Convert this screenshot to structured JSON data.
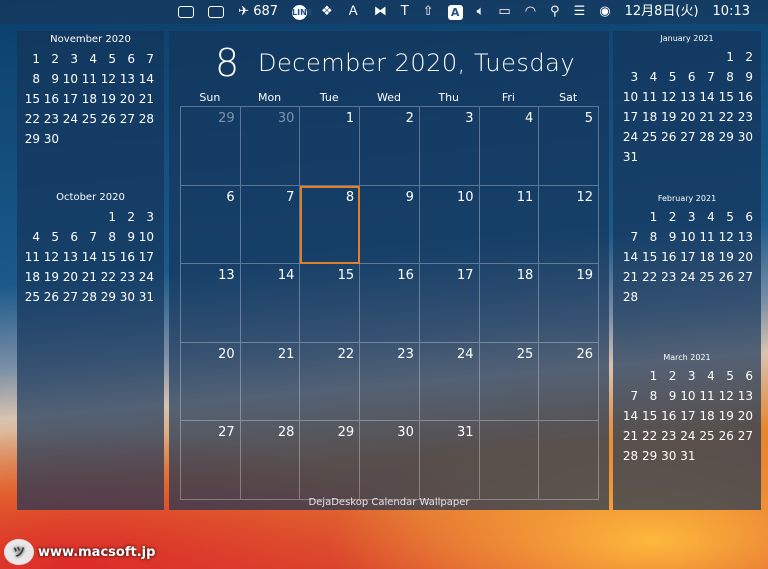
{
  "menubar": {
    "flight_count": "687",
    "line_label": "LINE",
    "text_tool_label": "T",
    "input_method": "A",
    "clock_date": "12月8日(火)",
    "clock_time": "10:13"
  },
  "left": {
    "months": [
      {
        "title": "November 2020",
        "days": [
          "1",
          "2",
          "3",
          "4",
          "5",
          "6",
          "7",
          "8",
          "9",
          "10",
          "11",
          "12",
          "13",
          "14",
          "15",
          "16",
          "17",
          "18",
          "19",
          "20",
          "21",
          "22",
          "23",
          "24",
          "25",
          "26",
          "27",
          "28",
          "29",
          "30"
        ]
      },
      {
        "title": "October 2020",
        "days": [
          "",
          "",
          "",
          "",
          "1",
          "2",
          "3",
          "4",
          "5",
          "6",
          "7",
          "8",
          "9",
          "10",
          "11",
          "12",
          "13",
          "14",
          "15",
          "16",
          "17",
          "18",
          "19",
          "20",
          "21",
          "22",
          "23",
          "24",
          "25",
          "26",
          "27",
          "28",
          "29",
          "30",
          "31"
        ]
      }
    ]
  },
  "center": {
    "day_number": "8",
    "date_text": "December 2020, Tuesday",
    "weekdays": [
      "Sun",
      "Mon",
      "Tue",
      "Wed",
      "Thu",
      "Fri",
      "Sat"
    ],
    "cells": [
      "29",
      "30",
      "1",
      "2",
      "3",
      "4",
      "5",
      "6",
      "7",
      "8",
      "9",
      "10",
      "11",
      "12",
      "13",
      "14",
      "15",
      "16",
      "17",
      "18",
      "19",
      "20",
      "21",
      "22",
      "23",
      "24",
      "25",
      "26",
      "27",
      "28",
      "29",
      "30",
      "31",
      "",
      ""
    ],
    "footer": "DejaDeskop Calendar Wallpaper"
  },
  "right": {
    "months": [
      {
        "title": "January 2021",
        "days": [
          "",
          "",
          "",
          "",
          "",
          "1",
          "2",
          "3",
          "4",
          "5",
          "6",
          "7",
          "8",
          "9",
          "10",
          "11",
          "12",
          "13",
          "14",
          "15",
          "16",
          "17",
          "18",
          "19",
          "20",
          "21",
          "22",
          "23",
          "24",
          "25",
          "26",
          "27",
          "28",
          "29",
          "30",
          "31"
        ]
      },
      {
        "title": "February 2021",
        "days": [
          "",
          "1",
          "2",
          "3",
          "4",
          "5",
          "6",
          "7",
          "8",
          "9",
          "10",
          "11",
          "12",
          "13",
          "14",
          "15",
          "16",
          "17",
          "18",
          "19",
          "20",
          "21",
          "22",
          "23",
          "24",
          "25",
          "26",
          "27",
          "28"
        ]
      },
      {
        "title": "March 2021",
        "days": [
          "",
          "1",
          "2",
          "3",
          "4",
          "5",
          "6",
          "7",
          "8",
          "9",
          "10",
          "11",
          "12",
          "13",
          "14",
          "15",
          "16",
          "17",
          "18",
          "19",
          "20",
          "21",
          "22",
          "23",
          "24",
          "25",
          "26",
          "27",
          "28",
          "29",
          "30",
          "31"
        ]
      }
    ]
  },
  "watermark": {
    "text": "www.macsoft.jp"
  },
  "colors": {
    "today_outline": "#e0802a",
    "panel": "#14345a"
  }
}
